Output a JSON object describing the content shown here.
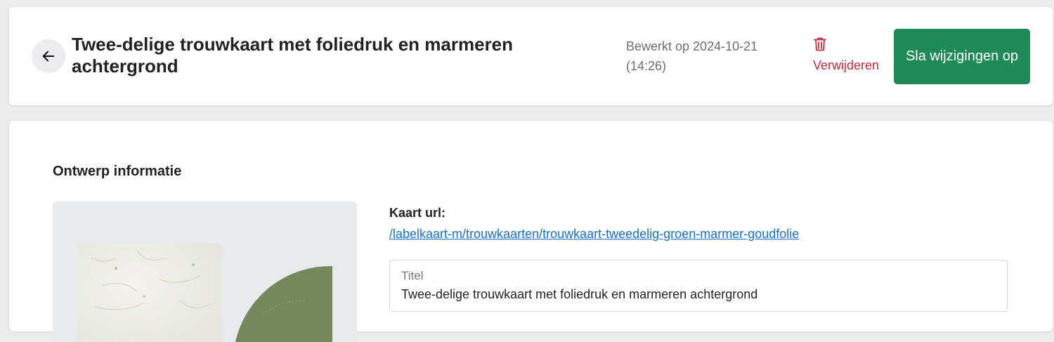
{
  "header": {
    "title": "Twee-delige trouwkaart met foliedruk en marmeren achtergrond",
    "edited_line1": "Bewerkt op 2024-10-21",
    "edited_line2": "(14:26)",
    "delete_label": "Verwijderen",
    "save_label": "Sla wijzigingen op",
    "back_icon": "arrow-left-icon",
    "delete_icon": "trash-icon"
  },
  "design_info": {
    "section_title": "Ontwerp informatie",
    "url_label": "Kaart url:",
    "url": "/labelkaart-m/trouwkaarten/trouwkaart-tweedelig-groen-marmer-goudfolie",
    "title_field_label": "Titel",
    "title_field_value": "Twee-delige trouwkaart met foliedruk en marmeren achtergrond"
  },
  "colors": {
    "save_button": "#1e8b57",
    "delete_text": "#c8283a",
    "link": "#1a6fd1"
  }
}
